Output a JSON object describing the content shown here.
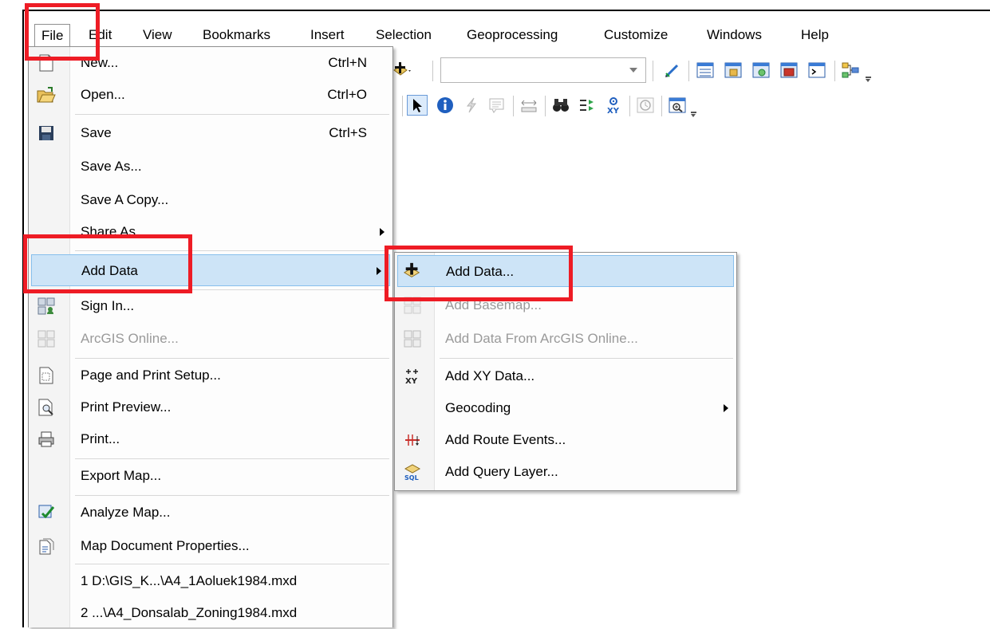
{
  "menubar": {
    "items": [
      "File",
      "Edit",
      "View",
      "Bookmarks",
      "Insert",
      "Selection",
      "Geoprocessing",
      "Customize",
      "Windows",
      "Help"
    ]
  },
  "toolbar": {
    "combo_value": ""
  },
  "file_menu": {
    "items": [
      {
        "label": "New...",
        "shortcut": "Ctrl+N",
        "icon": "new-document-icon"
      },
      {
        "label": "Open...",
        "shortcut": "Ctrl+O",
        "icon": "open-folder-icon"
      },
      {
        "label": "Save",
        "shortcut": "Ctrl+S",
        "icon": "floppy-disk-icon"
      },
      {
        "label": "Save As...",
        "shortcut": ""
      },
      {
        "label": "Save A Copy...",
        "shortcut": ""
      },
      {
        "label": "Share As",
        "shortcut": "",
        "submenu": true
      },
      {
        "label": "Add Data",
        "shortcut": "",
        "submenu": true,
        "highlighted": true
      },
      {
        "label": "Sign In...",
        "icon": "sign-in-icon"
      },
      {
        "label": "ArcGIS Online...",
        "icon": "arcgis-online-icon",
        "disabled": true
      },
      {
        "label": "Page and Print Setup...",
        "icon": "page-setup-icon"
      },
      {
        "label": "Print Preview...",
        "icon": "print-preview-icon"
      },
      {
        "label": "Print...",
        "icon": "printer-icon"
      },
      {
        "label": "Export Map..."
      },
      {
        "label": "Analyze Map...",
        "icon": "analyze-map-icon"
      },
      {
        "label": "Map Document Properties...",
        "icon": "document-properties-icon"
      },
      {
        "label": "1 D:\\GIS_K...\\A4_1Aoluek1984.mxd"
      },
      {
        "label": "2 ...\\A4_Donsalab_Zoning1984.mxd"
      }
    ]
  },
  "add_data_submenu": {
    "items": [
      {
        "label": "Add Data...",
        "icon": "add-data-icon",
        "highlighted": true
      },
      {
        "label": "Add Basemap...",
        "icon": "basemap-icon",
        "disabled": true
      },
      {
        "label": "Add Data From ArcGIS Online...",
        "icon": "arcgis-online-icon",
        "disabled": true
      },
      {
        "label": "Add XY Data...",
        "icon": "xy-data-icon"
      },
      {
        "label": "Geocoding",
        "submenu": true
      },
      {
        "label": "Add Route Events...",
        "icon": "route-events-icon"
      },
      {
        "label": "Add Query Layer...",
        "icon": "sql-query-icon"
      }
    ]
  },
  "colors": {
    "highlight": "#cde4f7",
    "highlight_border": "#87bfec",
    "callout": "#ee1c25",
    "disabled_text": "#9a9a9a"
  }
}
